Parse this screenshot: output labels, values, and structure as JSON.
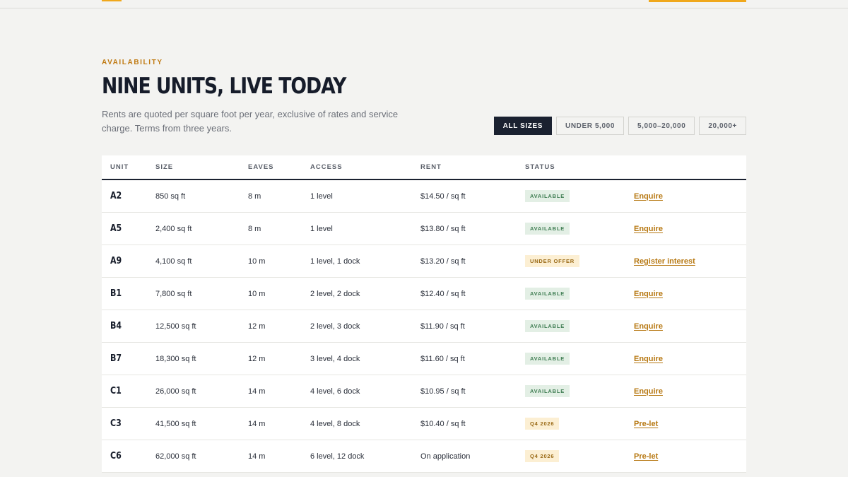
{
  "section": {
    "eyebrow": "AVAILABILITY",
    "title": "NINE UNITS, LIVE TODAY",
    "subtitle": "Rents are quoted per square foot per year, exclusive of rates and service charge. Terms from three years."
  },
  "filters": [
    {
      "label": "ALL SIZES",
      "active": true
    },
    {
      "label": "UNDER 5,000",
      "active": false
    },
    {
      "label": "5,000–20,000",
      "active": false
    },
    {
      "label": "20,000+",
      "active": false
    }
  ],
  "table": {
    "headers": [
      "UNIT",
      "SIZE",
      "EAVES",
      "ACCESS",
      "RENT",
      "STATUS"
    ],
    "rows": [
      {
        "unit": "A2",
        "size": "850 sq ft",
        "eaves": "8 m",
        "access": "1 level",
        "rent": "$14.50 / sq ft",
        "status": "AVAILABLE",
        "status_type": "available",
        "action": "Enquire"
      },
      {
        "unit": "A5",
        "size": "2,400 sq ft",
        "eaves": "8 m",
        "access": "1 level",
        "rent": "$13.80 / sq ft",
        "status": "AVAILABLE",
        "status_type": "available",
        "action": "Enquire"
      },
      {
        "unit": "A9",
        "size": "4,100 sq ft",
        "eaves": "10 m",
        "access": "1 level, 1 dock",
        "rent": "$13.20 / sq ft",
        "status": "UNDER OFFER",
        "status_type": "offer",
        "action": "Register interest"
      },
      {
        "unit": "B1",
        "size": "7,800 sq ft",
        "eaves": "10 m",
        "access": "2 level, 2 dock",
        "rent": "$12.40 / sq ft",
        "status": "AVAILABLE",
        "status_type": "available",
        "action": "Enquire"
      },
      {
        "unit": "B4",
        "size": "12,500 sq ft",
        "eaves": "12 m",
        "access": "2 level, 3 dock",
        "rent": "$11.90 / sq ft",
        "status": "AVAILABLE",
        "status_type": "available",
        "action": "Enquire"
      },
      {
        "unit": "B7",
        "size": "18,300 sq ft",
        "eaves": "12 m",
        "access": "3 level, 4 dock",
        "rent": "$11.60 / sq ft",
        "status": "AVAILABLE",
        "status_type": "available",
        "action": "Enquire"
      },
      {
        "unit": "C1",
        "size": "26,000 sq ft",
        "eaves": "14 m",
        "access": "4 level, 6 dock",
        "rent": "$10.95 / sq ft",
        "status": "AVAILABLE",
        "status_type": "available",
        "action": "Enquire"
      },
      {
        "unit": "C3",
        "size": "41,500 sq ft",
        "eaves": "14 m",
        "access": "4 level, 8 dock",
        "rent": "$10.40 / sq ft",
        "status": "Q4 2026",
        "status_type": "future",
        "action": "Pre-let"
      },
      {
        "unit": "C6",
        "size": "62,000 sq ft",
        "eaves": "14 m",
        "access": "6 level, 12 dock",
        "rent": "On application",
        "status": "Q4 2026",
        "status_type": "future",
        "action": "Pre-let"
      }
    ]
  },
  "colors": {
    "accent": "#f0a81c",
    "link": "#b77812",
    "dark": "#1a2130",
    "available_bg": "#e3efe5",
    "available_fg": "#3f7d52",
    "offer_bg": "#fcefd3",
    "offer_fg": "#9a6a16"
  }
}
